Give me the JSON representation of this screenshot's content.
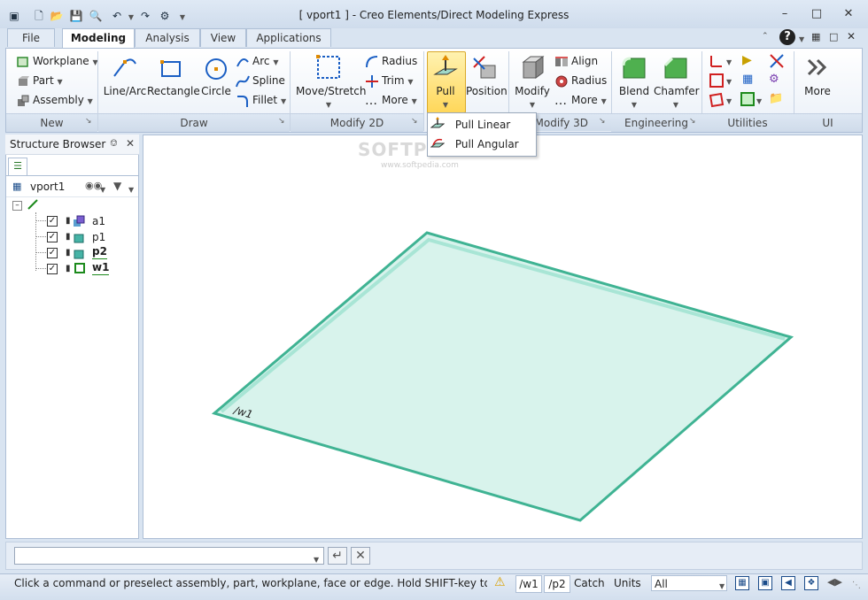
{
  "window": {
    "title": "[ vport1 ] - Creo Elements/Direct Modeling Express"
  },
  "tabs": [
    {
      "label": "File"
    },
    {
      "label": "Modeling"
    },
    {
      "label": "Analysis"
    },
    {
      "label": "View"
    },
    {
      "label": "Applications"
    }
  ],
  "ribbon": {
    "new": {
      "label": "New",
      "workplane": "Workplane",
      "part": "Part",
      "assembly": "Assembly"
    },
    "draw": {
      "label": "Draw",
      "line_arc": "Line/Arc",
      "rectangle": "Rectangle",
      "circle": "Circle",
      "arc": "Arc",
      "spline": "Spline",
      "fillet": "Fillet"
    },
    "modify2d": {
      "label": "Modify 2D",
      "move_stretch": "Move/Stretch",
      "radius": "Radius",
      "trim": "Trim",
      "more": "More"
    },
    "pull": {
      "label": "Pull",
      "position": "Position"
    },
    "modify3d": {
      "label": "Modify 3D",
      "modify": "Modify",
      "align": "Align",
      "radius": "Radius",
      "more": "More"
    },
    "engineering": {
      "label": "Engineering",
      "blend": "Blend",
      "chamfer": "Chamfer"
    },
    "utilities": {
      "label": "Utilities"
    },
    "ui": {
      "label": "UI",
      "more": "More"
    }
  },
  "dropdown": {
    "items": [
      "Pull Linear",
      "Pull Angular"
    ]
  },
  "browser": {
    "title": "Structure Browser",
    "viewport": "vport1",
    "items": [
      {
        "label": "a1"
      },
      {
        "label": "p1"
      },
      {
        "label": "p2"
      },
      {
        "label": "w1"
      }
    ]
  },
  "viewport": {
    "workplane_label": "/w1",
    "watermark": "SOFTPEDIA",
    "watermark_url": "www.softpedia.com"
  },
  "statusbar": {
    "message": "Click a command or preselect assembly, part, workplane, face or edge. Hold SHIFT-key to select m...",
    "workplane": "/w1",
    "part": "/p2",
    "catch": "Catch",
    "units": "Units",
    "filter": "All"
  },
  "colors": {
    "accent": "#1b4c8a",
    "highlight": "#ffd75a",
    "workplane_fill": "#d8f3ec",
    "workplane_edge": "#3fb393"
  }
}
